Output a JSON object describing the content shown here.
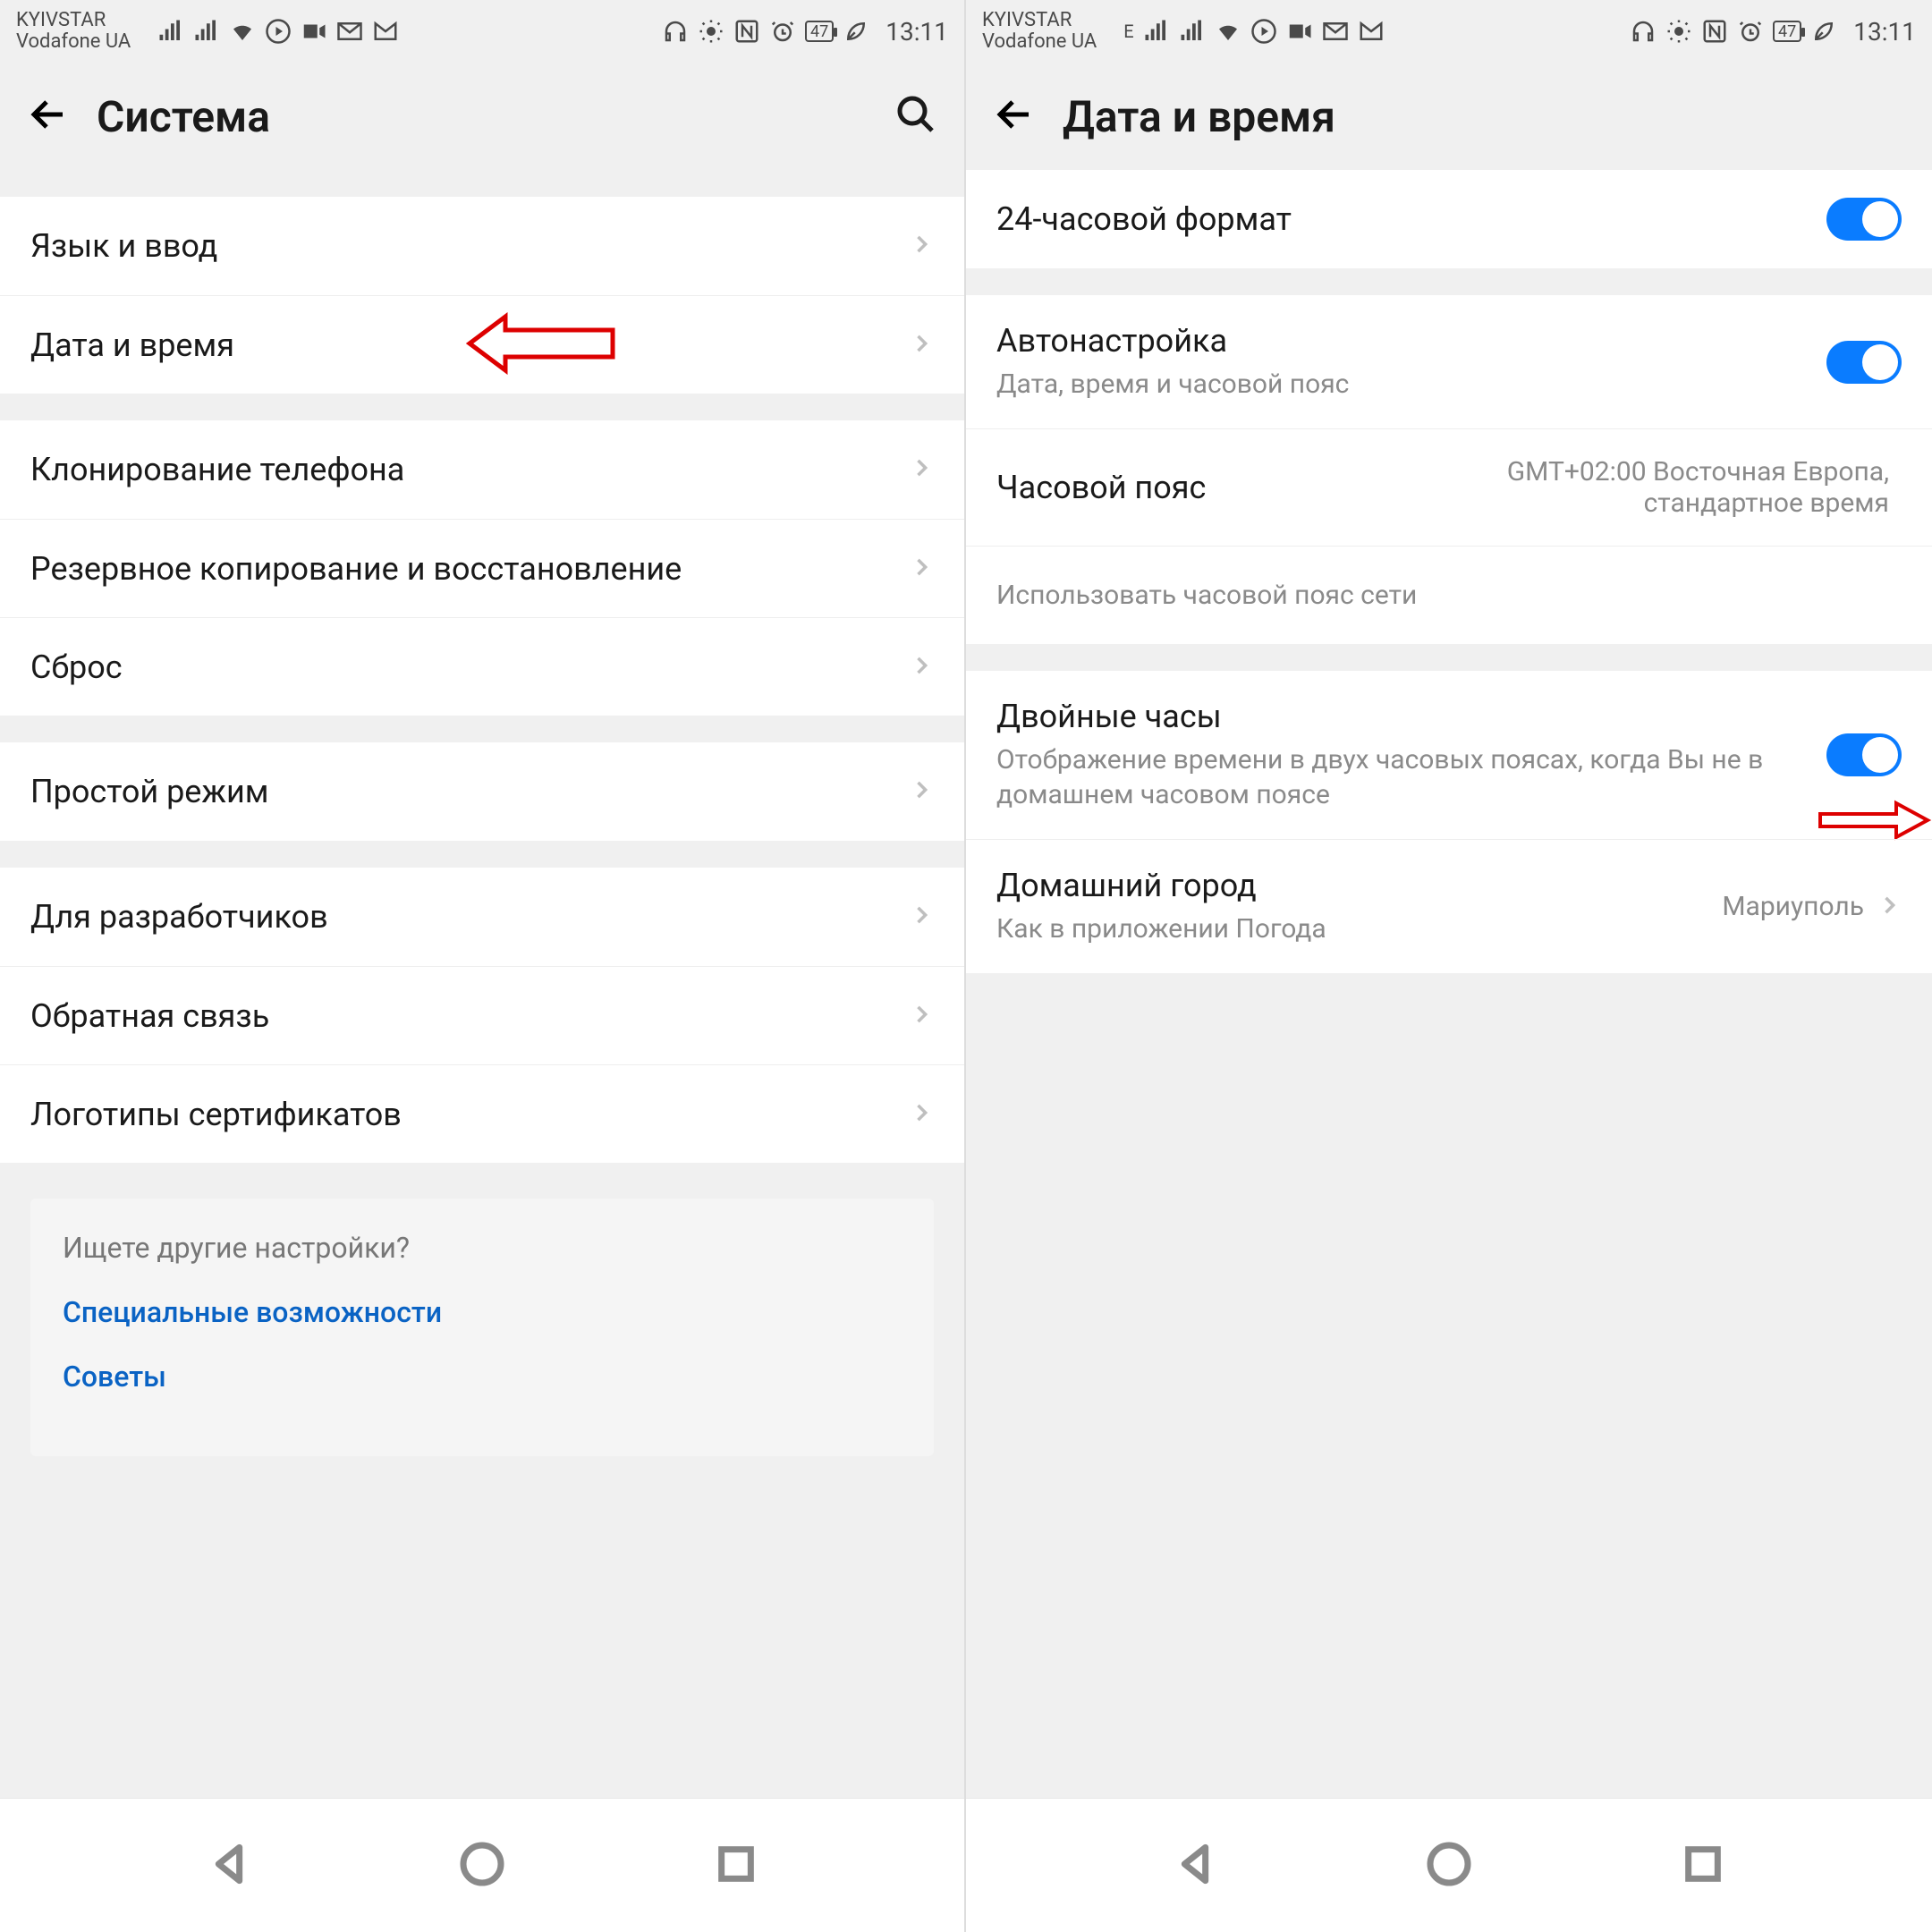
{
  "statusbar": {
    "carrier1": "KYIVSTAR",
    "carrier2": "Vodafone UA",
    "signal_e": "E",
    "battery": "47",
    "time": "13:11"
  },
  "left": {
    "title": "Система",
    "groups": [
      {
        "rows": [
          {
            "label": "Язык и ввод"
          },
          {
            "label": "Дата и время",
            "annot": "left"
          }
        ]
      },
      {
        "rows": [
          {
            "label": "Клонирование телефона"
          },
          {
            "label": "Резервное копирование и восстановление"
          },
          {
            "label": "Сброс"
          }
        ]
      },
      {
        "rows": [
          {
            "label": "Простой режим"
          }
        ]
      },
      {
        "rows": [
          {
            "label": "Для разработчиков"
          },
          {
            "label": "Обратная связь"
          },
          {
            "label": "Логотипы сертификатов"
          }
        ]
      }
    ],
    "hint": {
      "title": "Ищете другие настройки?",
      "links": [
        "Специальные возможности",
        "Советы"
      ]
    }
  },
  "right": {
    "title": "Дата и время",
    "groups": [
      {
        "rows": [
          {
            "label": "24-часовой формат",
            "toggle": true
          }
        ]
      },
      {
        "rows": [
          {
            "label": "Автонастройка",
            "sublabel": "Дата, время и часовой пояс",
            "toggle": true
          },
          {
            "label": "Часовой пояс",
            "value": "GMT+02:00 Восточная Европа, стандартное время"
          },
          {
            "sublabel_only": "Использовать часовой пояс сети"
          }
        ]
      },
      {
        "rows": [
          {
            "label": "Двойные часы",
            "sublabel": "Отображение времени в двух часовых поясах, когда Вы не в домашнем часовом поясе",
            "toggle": true,
            "annot": "right"
          },
          {
            "label": "Домашний город",
            "sublabel": "Как в приложении Погода",
            "value": "Мариуполь",
            "chevron": true
          }
        ]
      }
    ]
  }
}
